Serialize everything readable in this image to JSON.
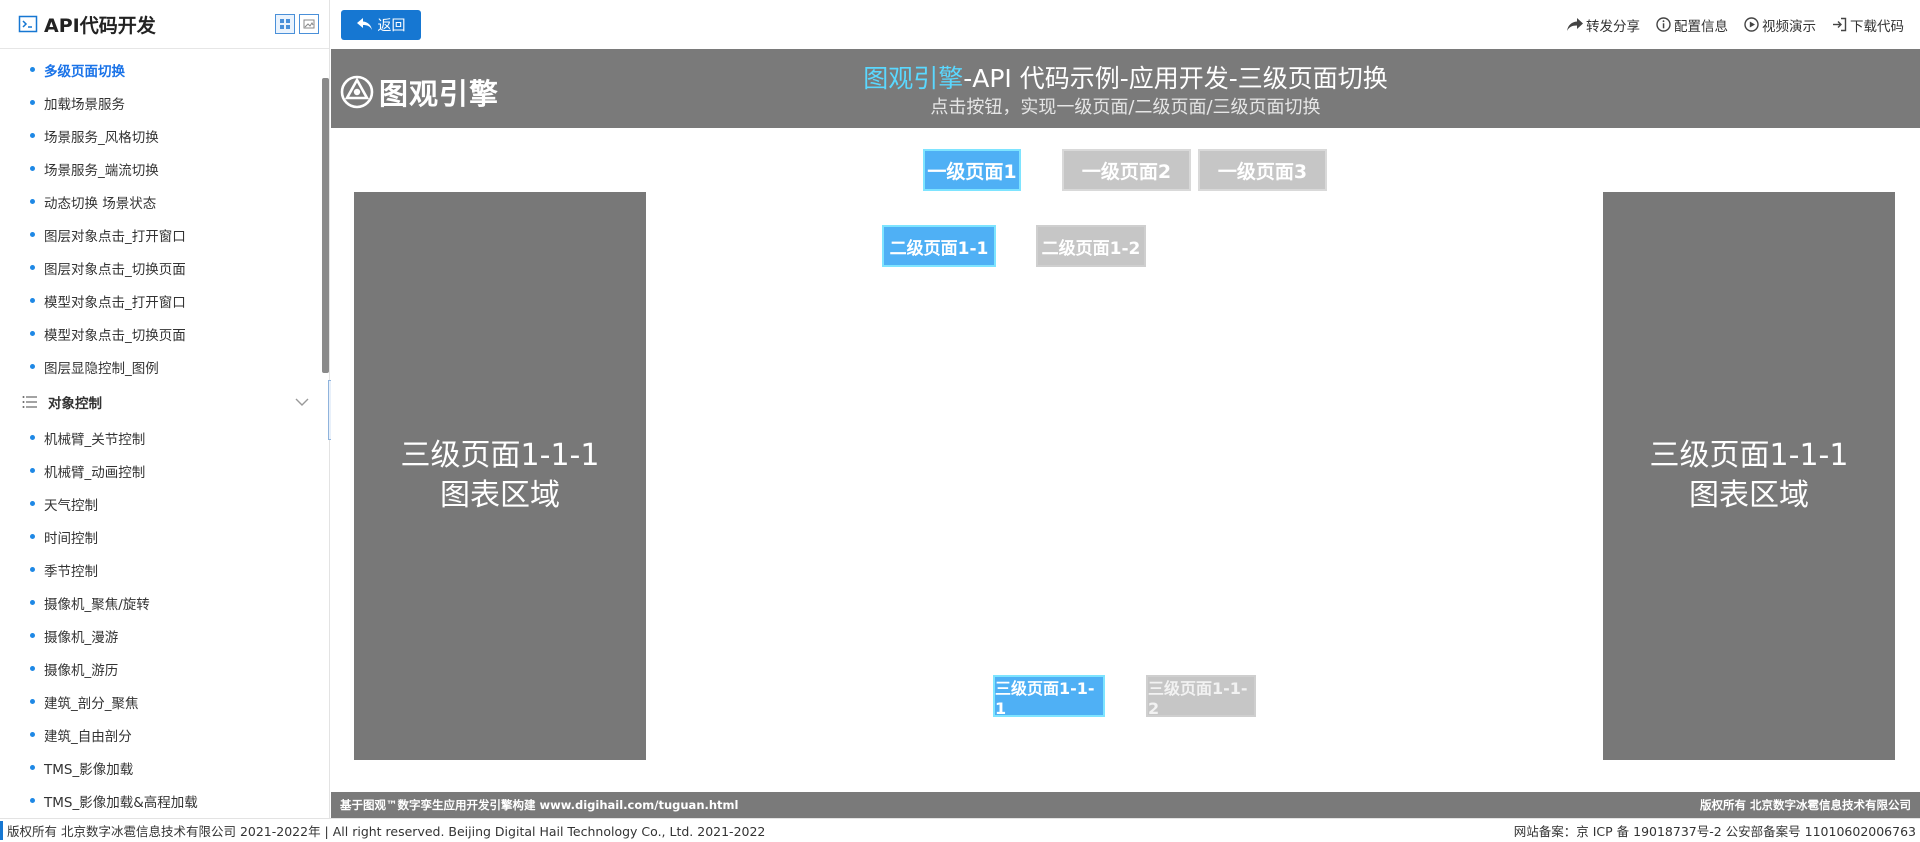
{
  "sidebar": {
    "title": "API代码开发",
    "items_top": [
      {
        "label": "多级页面切换",
        "active": true
      },
      {
        "label": "加载场景服务"
      },
      {
        "label": "场景服务_风格切换"
      },
      {
        "label": "场景服务_端流切换"
      },
      {
        "label": "动态切换 场景状态"
      },
      {
        "label": "图层对象点击_打开窗口"
      },
      {
        "label": "图层对象点击_切换页面"
      },
      {
        "label": "模型对象点击_打开窗口"
      },
      {
        "label": "模型对象点击_切换页面"
      },
      {
        "label": "图层显隐控制_图例"
      }
    ],
    "group_label": "对象控制",
    "items_group": [
      {
        "label": "机械臂_关节控制"
      },
      {
        "label": "机械臂_动画控制"
      },
      {
        "label": "天气控制"
      },
      {
        "label": "时间控制"
      },
      {
        "label": "季节控制"
      },
      {
        "label": "摄像机_聚焦/旋转"
      },
      {
        "label": "摄像机_漫游"
      },
      {
        "label": "摄像机_游历"
      },
      {
        "label": "建筑_剖分_聚焦"
      },
      {
        "label": "建筑_自由剖分"
      },
      {
        "label": "TMS_影像加载"
      },
      {
        "label": "TMS_影像加载&高程加载"
      }
    ]
  },
  "toolbar": {
    "back_label": "返回",
    "links": [
      {
        "label": "转发分享",
        "icon": "share-icon"
      },
      {
        "label": "配置信息",
        "icon": "info-icon"
      },
      {
        "label": "视频演示",
        "icon": "play-icon"
      },
      {
        "label": "下载代码",
        "icon": "download-icon"
      }
    ]
  },
  "demo": {
    "brand": "图观引擎",
    "title_highlight": "图观引擎",
    "title_rest": "-API 代码示例-应用开发-三级页面切换",
    "subtitle": "点击按钮，实现一级页面/二级页面/三级页面切换",
    "level1": [
      "一级页面1",
      "一级页面2",
      "一级页面3"
    ],
    "level2": [
      "二级页面1-1",
      "二级页面1-2"
    ],
    "level3": [
      "三级页面1-1-1",
      "三级页面1-1-2"
    ],
    "left_panel": {
      "line1": "三级页面1-1-1",
      "line2": "图表区域"
    },
    "right_panel": {
      "line1": "三级页面1-1-1",
      "line2": "图表区域"
    },
    "footer_left": "基于图观™数字孪生应用开发引擎构建 www.digihail.com/tuguan.html",
    "footer_right": "版权所有 北京数字冰雹信息技术有限公司"
  },
  "page_footer": {
    "left": "版权所有 北京数字冰雹信息技术有限公司 2021-2022年 | All right reserved. Beijing Digital Hail Technology Co., Ltd. 2021-2022",
    "right": "网站备案：京 ICP 备 19018737号-2 公安部备案号 11010602006763"
  },
  "colors": {
    "accent": "#1677d2",
    "active_button": "#4fb0f5",
    "inactive_button": "#c6c6c6",
    "panel": "#787878",
    "title_highlight": "#5ad8ff"
  }
}
